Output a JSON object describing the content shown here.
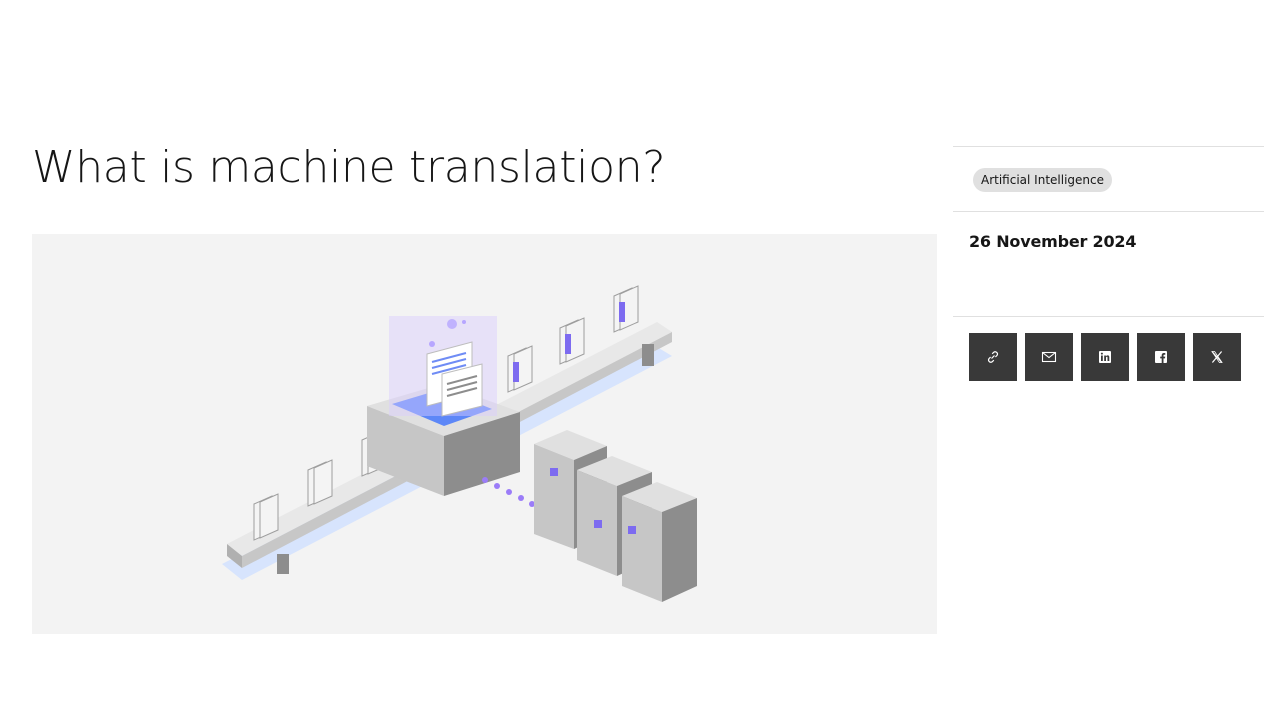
{
  "article": {
    "title": "What is machine translation?",
    "topic_tag": "Artificial Intelligence",
    "date": "26 November 2024",
    "hero_image": {
      "kind": "illustration",
      "background_color": "#f3f3f3"
    }
  },
  "share": {
    "buttons": [
      {
        "icon": "link-icon"
      },
      {
        "icon": "email-icon"
      },
      {
        "icon": "linkedin-icon"
      },
      {
        "icon": "facebook-icon"
      },
      {
        "icon": "x-icon"
      }
    ],
    "button_color": "#393939",
    "icon_color": "#ffffff"
  }
}
